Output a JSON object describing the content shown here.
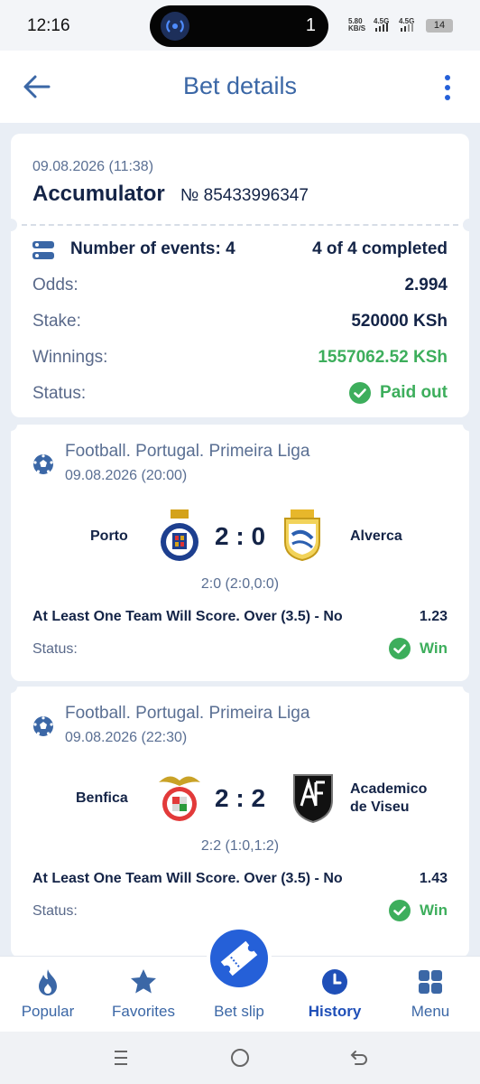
{
  "status_bar": {
    "time": "12:16",
    "notification_count": "1",
    "net_speed": "5.80",
    "net_unit": "KB/S",
    "signal1": "4.5G",
    "signal2": "4.5G",
    "battery": "14"
  },
  "header": {
    "title": "Bet details"
  },
  "bet": {
    "date": "09.08.2026 (11:38)",
    "type": "Accumulator",
    "number": "№ 85433996347",
    "events_label": "Number of events: 4",
    "events_completed": "4 of 4 completed",
    "odds_label": "Odds:",
    "odds_value": "2.994",
    "stake_label": "Stake:",
    "stake_value": "520000 KSh",
    "winnings_label": "Winnings:",
    "winnings_value": "1557062.52 KSh",
    "status_label": "Status:",
    "status_value": "Paid out"
  },
  "events": [
    {
      "league": "Football. Portugal. Primeira Liga",
      "date": "09.08.2026 (20:00)",
      "home": "Porto",
      "away": "Alverca",
      "score": "2 : 0",
      "halftime": "2:0 (2:0,0:0)",
      "market": "At Least One Team Will Score. Over (3.5) - No",
      "odds": "1.23",
      "status_label": "Status:",
      "status": "Win"
    },
    {
      "league": "Football. Portugal. Primeira Liga",
      "date": "09.08.2026 (22:30)",
      "home": "Benfica",
      "away_line1": "Academico",
      "away_line2": "de Viseu",
      "score": "2 : 2",
      "halftime": "2:2 (1:0,1:2)",
      "market": "At Least One Team Will Score. Over (3.5) - No",
      "odds": "1.43",
      "status_label": "Status:",
      "status": "Win"
    }
  ],
  "bottom_nav": [
    {
      "label": "Popular",
      "icon": "flame-icon"
    },
    {
      "label": "Favorites",
      "icon": "star-icon"
    },
    {
      "label": "Bet slip",
      "icon": "ticket-icon"
    },
    {
      "label": "History",
      "icon": "clock-icon"
    },
    {
      "label": "Menu",
      "icon": "grid-icon"
    }
  ],
  "colors": {
    "accent": "#3b67a6",
    "primary": "#2560d8",
    "success": "#3dae5c",
    "background": "#e9eef5"
  }
}
